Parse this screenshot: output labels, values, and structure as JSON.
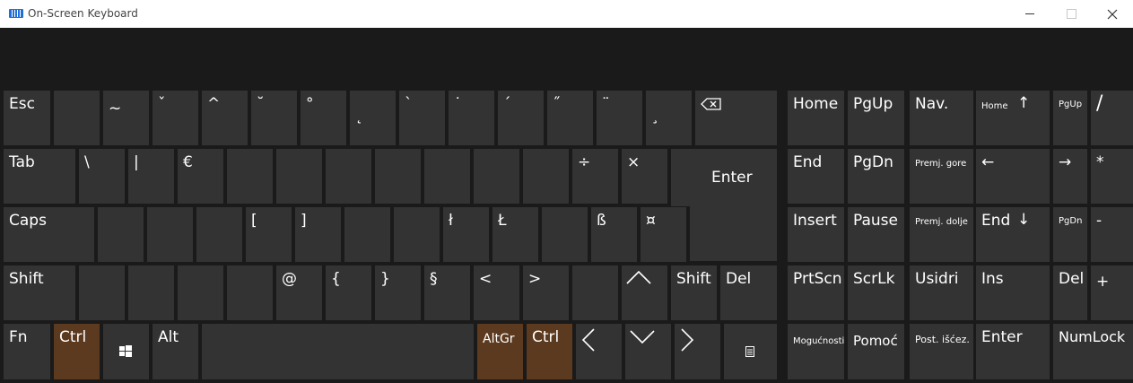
{
  "window": {
    "title": "On-Screen Keyboard"
  },
  "main": {
    "esc": "Esc",
    "tilde": "~",
    "caron": "ˇ",
    "circumflex": "^",
    "breve": "˘",
    "ring": "°",
    "ogonek": "˛",
    "grave": "`",
    "dot": "˙",
    "acute": "´",
    "dblacute": "˝",
    "diaeresis": "¨",
    "cedilla": "¸",
    "tab": "Tab",
    "backslash": "\\",
    "pipe": "|",
    "euro": "€",
    "divide": "÷",
    "times": "×",
    "enter": "Enter",
    "caps": "Caps",
    "lbracket": "[",
    "rbracket": "]",
    "l_stroke": "ł",
    "L_stroke": "Ł",
    "sharp_s": "ß",
    "currency": "¤",
    "shift_left": "Shift",
    "at": "@",
    "lbrace": "{",
    "rbrace": "}",
    "section": "§",
    "lt": "<",
    "gt": ">",
    "shift_right": "Shift",
    "del": "Del",
    "fn": "Fn",
    "ctrl_left": "Ctrl",
    "alt": "Alt",
    "altgr": "AltGr",
    "ctrl_right": "Ctrl"
  },
  "nav": {
    "home": "Home",
    "pgup": "PgUp",
    "navkey": "Nav.",
    "end": "End",
    "pgdn": "PgDn",
    "move_up": "Premj. gore",
    "insert": "Insert",
    "pause": "Pause",
    "move_down": "Premj. dolje",
    "prtscn": "PrtScn",
    "scrlk": "ScrLk",
    "dock": "Usidri",
    "options": "Mogućnosti",
    "help": "Pomoć",
    "fade": "Post. išćez."
  },
  "numpad": {
    "home": "Home",
    "up": "↑",
    "pgup": "PgUp",
    "divide": "/",
    "left": "←",
    "right": "→",
    "multiply": "*",
    "end": "End",
    "down": "↓",
    "pgdn": "PgDn",
    "minus": "-",
    "ins": "Ins",
    "del": "Del",
    "plus": "+",
    "enter": "Enter",
    "numlock": "NumLock"
  },
  "colors": {
    "key": "#333333",
    "modifier_active": "#5c3a1f",
    "background": "#1a1a1a"
  }
}
